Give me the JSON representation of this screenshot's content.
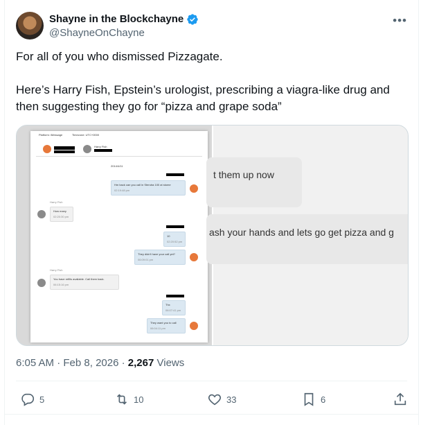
{
  "author": {
    "display_name": "Shayne in the Blockchayne",
    "handle": "@ShayneOnChayne"
  },
  "tweet": {
    "paragraph1": "For all of you who dismissed Pizzagate.",
    "paragraph2": "Here’s Harry Fish, Epstein’s urologist, prescribing a viagra-like drug and then suggesting they go for “pizza and grape soda”"
  },
  "media": {
    "right_line1": "t them up now",
    "right_line2": "ash your hands and lets go get pizza and g",
    "screenshot": {
      "platform": "Platform: iMessage",
      "timezone": "Timezone: UTC+0000",
      "contact": "Harry Fish",
      "date": "2014/4/11",
      "msg1": "Hm back can you call in Stendra 100 at stome",
      "msg1_time": "02:19:48 pm",
      "sender_label": "Harry Fish",
      "msg2": "How many",
      "msg2_time": "02:20:30 pm",
      "msg3": "10",
      "msg3_time": "02:20:52 pm",
      "msg4": "They didn't have your call yet?",
      "msg4_time": "06:09:01 pm",
      "sender_label2": "Harry Fish",
      "msg5": "You have refills available. Call them back.",
      "msg5_time": "06:15:16 pm",
      "msg6": "Thx",
      "msg6_time": "06:07:41 pm",
      "msg7": "They want you to call",
      "msg7_time": "06:04:11 pm"
    }
  },
  "meta": {
    "time": "6:05 AM",
    "date": "Feb 8, 2026",
    "views_count": "2,267",
    "views_label": "Views"
  },
  "actions": {
    "replies": "5",
    "reposts": "10",
    "likes": "33",
    "bookmarks": "6"
  },
  "colors": {
    "verified": "#1d9bf0",
    "muted": "#536471",
    "text": "#0f1419"
  }
}
